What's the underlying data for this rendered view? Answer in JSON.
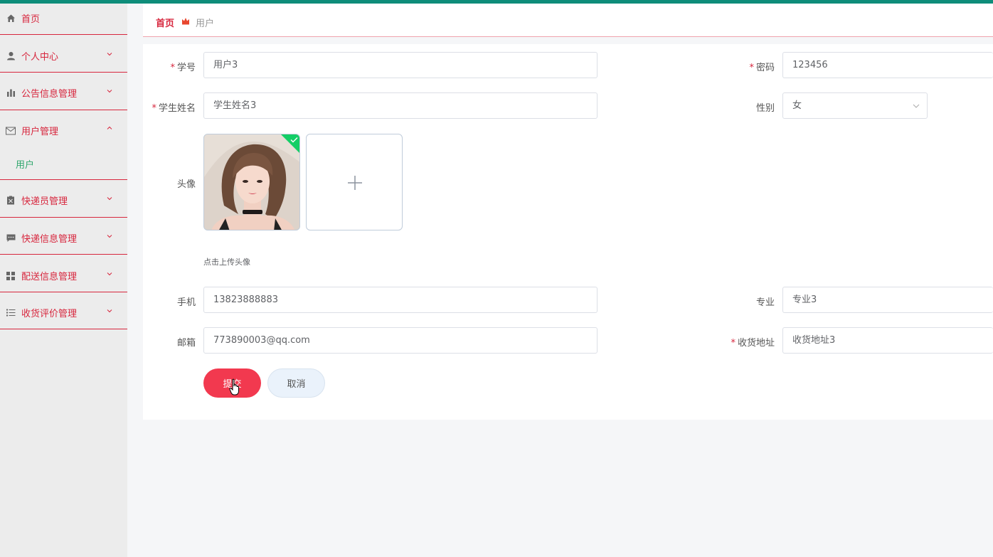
{
  "sidebar": {
    "home": "首页",
    "personal": "个人中心",
    "notice": "公告信息管理",
    "users": "用户管理",
    "users_sub": "用户",
    "courier": "快递员管理",
    "express": "快递信息管理",
    "delivery": "配送信息管理",
    "review": "收货评价管理"
  },
  "breadcrumb": {
    "home": "首页",
    "current": "用户"
  },
  "form": {
    "student_no_label": "学号",
    "student_no_value": "用户3",
    "password_label": "密码",
    "password_value": "123456",
    "name_label": "学生姓名",
    "name_value": "学生姓名3",
    "gender_label": "性别",
    "gender_value": "女",
    "avatar_label": "头像",
    "upload_hint": "点击上传头像",
    "phone_label": "手机",
    "phone_value": "13823888883",
    "major_label": "专业",
    "major_value": "专业3",
    "email_label": "邮箱",
    "email_value": "773890003@qq.com",
    "address_label": "收货地址",
    "address_value": "收货地址3",
    "required_mark": "*"
  },
  "buttons": {
    "submit": "提交",
    "cancel": "取消"
  },
  "colors": {
    "accent": "#d7263d",
    "submit": "#f2394f",
    "topbar": "#0e8d7a",
    "active_sub": "#2fa66c"
  }
}
